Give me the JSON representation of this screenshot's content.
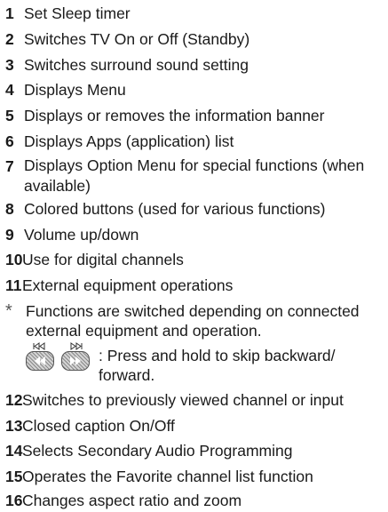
{
  "items": [
    {
      "num": "1",
      "text": "Set Sleep timer"
    },
    {
      "num": "2",
      "text": "Switches TV On or Off (Standby)"
    },
    {
      "num": "3",
      "text": "Switches surround sound setting"
    },
    {
      "num": "4",
      "text": "Displays Menu"
    },
    {
      "num": "5",
      "text": "Displays or removes the information banner"
    },
    {
      "num": "6",
      "text": "Displays Apps (application) list"
    },
    {
      "num": "7",
      "text": "Displays Option Menu for special functions (when available)"
    },
    {
      "num": "8",
      "text": "Colored buttons (used for various functions)"
    },
    {
      "num": "9",
      "text": "Volume up/down"
    },
    {
      "num": "10",
      "text": "Use for digital channels"
    },
    {
      "num": "11",
      "text": "External equipment operations"
    },
    {
      "num": "*",
      "text": "Functions are switched depending on connected external equipment and operation."
    },
    {
      "num": "12",
      "text": "Switches to previously viewed channel or input"
    },
    {
      "num": "13",
      "text": "Closed caption On/Off"
    },
    {
      "num": "14",
      "text": "Selects Secondary Audio Programming"
    },
    {
      "num": "15",
      "text": "Operates the Favorite channel list function"
    },
    {
      "num": "16",
      "text": "Changes aspect ratio and zoom"
    }
  ],
  "skip_note": ": Press and hold to skip backward/ forward.",
  "icons": [
    "skip-backward-icon",
    "skip-forward-icon"
  ]
}
